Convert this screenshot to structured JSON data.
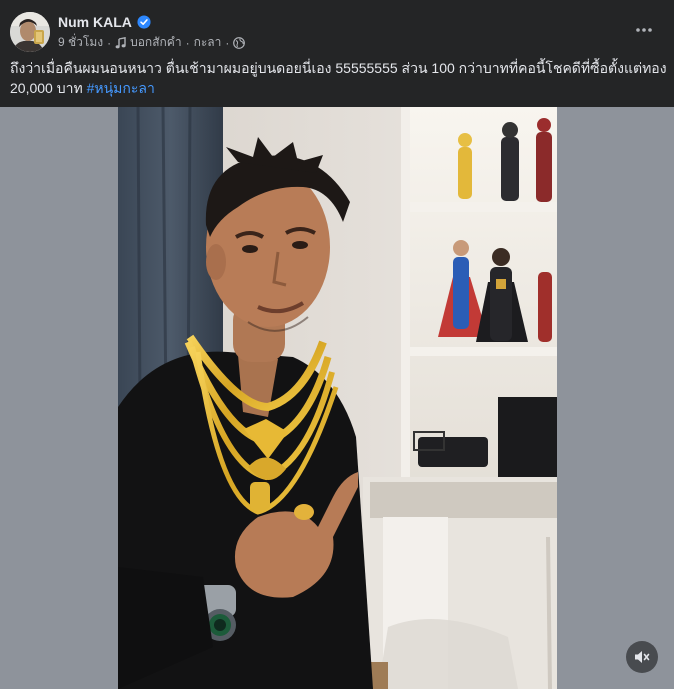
{
  "post": {
    "author": "Num KALA",
    "time": "9 ชั่วโมง",
    "separator": "·",
    "music_label": "บอกสักคำ",
    "music_artist": "กะลา",
    "caption_line1": "ถึงว่าเมื่อคืนผมนอนหนาว ตื่นเช้ามาผมอยู่บนดอยนี่เอง 55555555 ส่วน 100 กว่าบาทที่คอนี้โชคดีที่ซื้อตั้งแต่ทอง",
    "caption_line2": "20,000 บาท",
    "hashtag": "#หนุ่มกะลา"
  },
  "icons": {
    "verified": "verified-badge-icon",
    "music": "music-note-icon",
    "audience": "globe-icon",
    "more": "more-options-icon",
    "mute": "speaker-muted-icon"
  },
  "colors": {
    "background": "#242526",
    "text": "#e4e6eb",
    "secondary": "#b0b3b8",
    "link": "#4599ff",
    "verified": "#2d88ff",
    "media_backdrop": "#8e939b"
  }
}
